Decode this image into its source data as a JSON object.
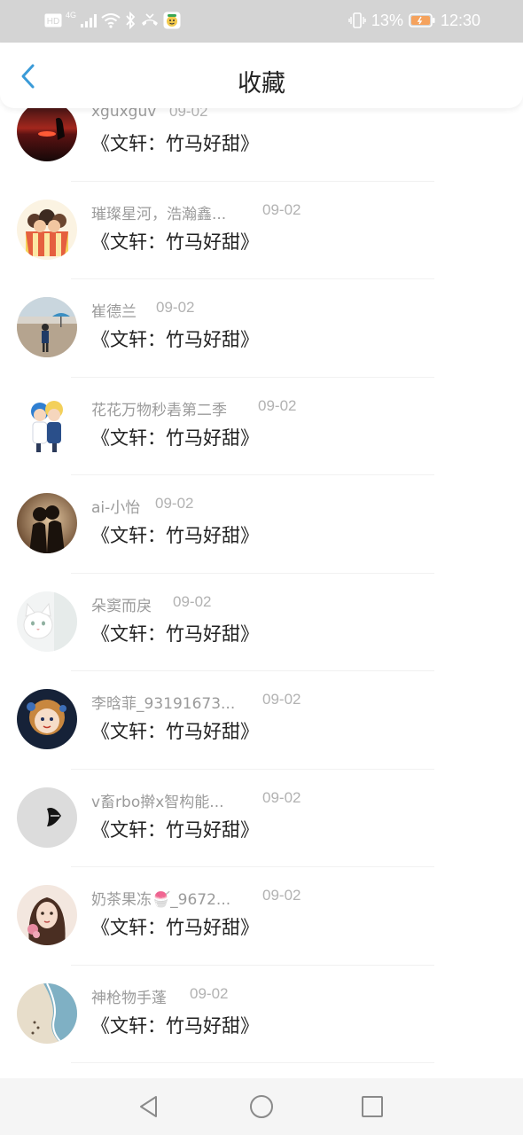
{
  "status_bar": {
    "network_label": "4G",
    "hd_label": "HD",
    "battery_percent": "13%",
    "time": "12:30"
  },
  "header": {
    "title": "收藏"
  },
  "colors": {
    "accent": "#3a9bd8",
    "status_bar_bg": "#d4d4d4",
    "title_text": "#222222",
    "meta_text": "#9b9b9b"
  },
  "items": [
    {
      "user": "xguxguv",
      "date": "09-02",
      "title": "《文轩：竹马好甜》",
      "avatar": "sunset-silhouette-avatar"
    },
    {
      "user": "璀璨星河，浩瀚鑫...",
      "date": "09-02",
      "title": "《文轩：竹马好甜》",
      "avatar": "cartoon-group-avatar"
    },
    {
      "user": "崔德兰",
      "date": "09-02",
      "title": "《文轩：竹马好甜》",
      "avatar": "beach-photo-avatar"
    },
    {
      "user": "花花万物秒砉第二季",
      "date": "09-02",
      "title": "《文轩：竹马好甜》",
      "avatar": "anime-characters-avatar"
    },
    {
      "user": "ai-小怡",
      "date": "09-02",
      "title": "《文轩：竹马好甜》",
      "avatar": "couple-silhouette-avatar"
    },
    {
      "user": "朵窦而戾",
      "date": "09-02",
      "title": "《文轩：竹马好甜》",
      "avatar": "white-cat-avatar"
    },
    {
      "user": "李晗菲_93191673...",
      "date": "09-02",
      "title": "《文轩：竹马好甜》",
      "avatar": "anime-boy-avatar"
    },
    {
      "user": "v畜rbo擀x智构能...",
      "date": "09-02",
      "title": "《文轩：竹马好甜》",
      "avatar": "lips-avatar"
    },
    {
      "user": "奶茶果冻🍧_9672...",
      "date": "09-02",
      "title": "《文轩：竹马好甜》",
      "avatar": "illustrated-girl-avatar"
    },
    {
      "user": "神枪物手蓬",
      "date": "09-02",
      "title": "《文轩：竹马好甜》",
      "avatar": "shoreline-avatar"
    }
  ]
}
